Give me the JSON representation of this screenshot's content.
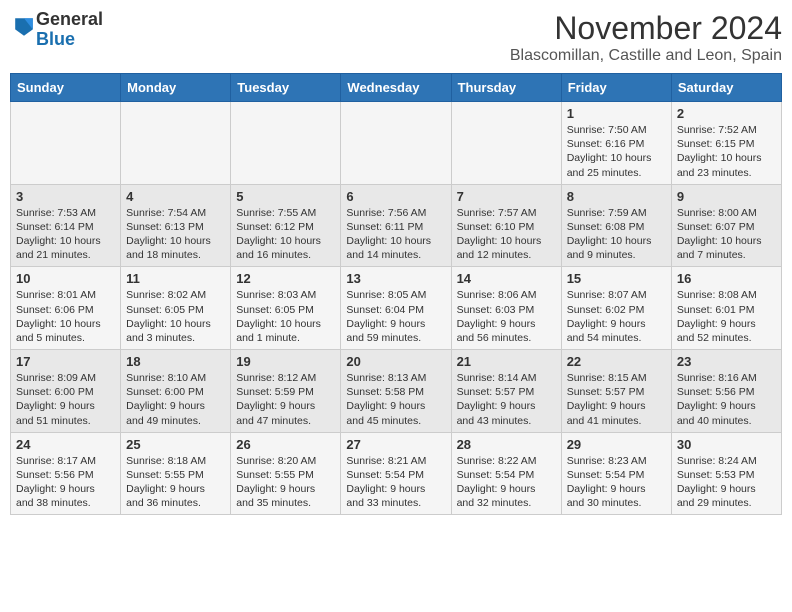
{
  "logo": {
    "general": "General",
    "blue": "Blue"
  },
  "header": {
    "month": "November 2024",
    "location": "Blascomillan, Castille and Leon, Spain"
  },
  "weekdays": [
    "Sunday",
    "Monday",
    "Tuesday",
    "Wednesday",
    "Thursday",
    "Friday",
    "Saturday"
  ],
  "weeks": [
    [
      {
        "day": "",
        "info": ""
      },
      {
        "day": "",
        "info": ""
      },
      {
        "day": "",
        "info": ""
      },
      {
        "day": "",
        "info": ""
      },
      {
        "day": "",
        "info": ""
      },
      {
        "day": "1",
        "info": "Sunrise: 7:50 AM\nSunset: 6:16 PM\nDaylight: 10 hours and 25 minutes."
      },
      {
        "day": "2",
        "info": "Sunrise: 7:52 AM\nSunset: 6:15 PM\nDaylight: 10 hours and 23 minutes."
      }
    ],
    [
      {
        "day": "3",
        "info": "Sunrise: 7:53 AM\nSunset: 6:14 PM\nDaylight: 10 hours and 21 minutes."
      },
      {
        "day": "4",
        "info": "Sunrise: 7:54 AM\nSunset: 6:13 PM\nDaylight: 10 hours and 18 minutes."
      },
      {
        "day": "5",
        "info": "Sunrise: 7:55 AM\nSunset: 6:12 PM\nDaylight: 10 hours and 16 minutes."
      },
      {
        "day": "6",
        "info": "Sunrise: 7:56 AM\nSunset: 6:11 PM\nDaylight: 10 hours and 14 minutes."
      },
      {
        "day": "7",
        "info": "Sunrise: 7:57 AM\nSunset: 6:10 PM\nDaylight: 10 hours and 12 minutes."
      },
      {
        "day": "8",
        "info": "Sunrise: 7:59 AM\nSunset: 6:08 PM\nDaylight: 10 hours and 9 minutes."
      },
      {
        "day": "9",
        "info": "Sunrise: 8:00 AM\nSunset: 6:07 PM\nDaylight: 10 hours and 7 minutes."
      }
    ],
    [
      {
        "day": "10",
        "info": "Sunrise: 8:01 AM\nSunset: 6:06 PM\nDaylight: 10 hours and 5 minutes."
      },
      {
        "day": "11",
        "info": "Sunrise: 8:02 AM\nSunset: 6:05 PM\nDaylight: 10 hours and 3 minutes."
      },
      {
        "day": "12",
        "info": "Sunrise: 8:03 AM\nSunset: 6:05 PM\nDaylight: 10 hours and 1 minute."
      },
      {
        "day": "13",
        "info": "Sunrise: 8:05 AM\nSunset: 6:04 PM\nDaylight: 9 hours and 59 minutes."
      },
      {
        "day": "14",
        "info": "Sunrise: 8:06 AM\nSunset: 6:03 PM\nDaylight: 9 hours and 56 minutes."
      },
      {
        "day": "15",
        "info": "Sunrise: 8:07 AM\nSunset: 6:02 PM\nDaylight: 9 hours and 54 minutes."
      },
      {
        "day": "16",
        "info": "Sunrise: 8:08 AM\nSunset: 6:01 PM\nDaylight: 9 hours and 52 minutes."
      }
    ],
    [
      {
        "day": "17",
        "info": "Sunrise: 8:09 AM\nSunset: 6:00 PM\nDaylight: 9 hours and 51 minutes."
      },
      {
        "day": "18",
        "info": "Sunrise: 8:10 AM\nSunset: 6:00 PM\nDaylight: 9 hours and 49 minutes."
      },
      {
        "day": "19",
        "info": "Sunrise: 8:12 AM\nSunset: 5:59 PM\nDaylight: 9 hours and 47 minutes."
      },
      {
        "day": "20",
        "info": "Sunrise: 8:13 AM\nSunset: 5:58 PM\nDaylight: 9 hours and 45 minutes."
      },
      {
        "day": "21",
        "info": "Sunrise: 8:14 AM\nSunset: 5:57 PM\nDaylight: 9 hours and 43 minutes."
      },
      {
        "day": "22",
        "info": "Sunrise: 8:15 AM\nSunset: 5:57 PM\nDaylight: 9 hours and 41 minutes."
      },
      {
        "day": "23",
        "info": "Sunrise: 8:16 AM\nSunset: 5:56 PM\nDaylight: 9 hours and 40 minutes."
      }
    ],
    [
      {
        "day": "24",
        "info": "Sunrise: 8:17 AM\nSunset: 5:56 PM\nDaylight: 9 hours and 38 minutes."
      },
      {
        "day": "25",
        "info": "Sunrise: 8:18 AM\nSunset: 5:55 PM\nDaylight: 9 hours and 36 minutes."
      },
      {
        "day": "26",
        "info": "Sunrise: 8:20 AM\nSunset: 5:55 PM\nDaylight: 9 hours and 35 minutes."
      },
      {
        "day": "27",
        "info": "Sunrise: 8:21 AM\nSunset: 5:54 PM\nDaylight: 9 hours and 33 minutes."
      },
      {
        "day": "28",
        "info": "Sunrise: 8:22 AM\nSunset: 5:54 PM\nDaylight: 9 hours and 32 minutes."
      },
      {
        "day": "29",
        "info": "Sunrise: 8:23 AM\nSunset: 5:54 PM\nDaylight: 9 hours and 30 minutes."
      },
      {
        "day": "30",
        "info": "Sunrise: 8:24 AM\nSunset: 5:53 PM\nDaylight: 9 hours and 29 minutes."
      }
    ]
  ]
}
